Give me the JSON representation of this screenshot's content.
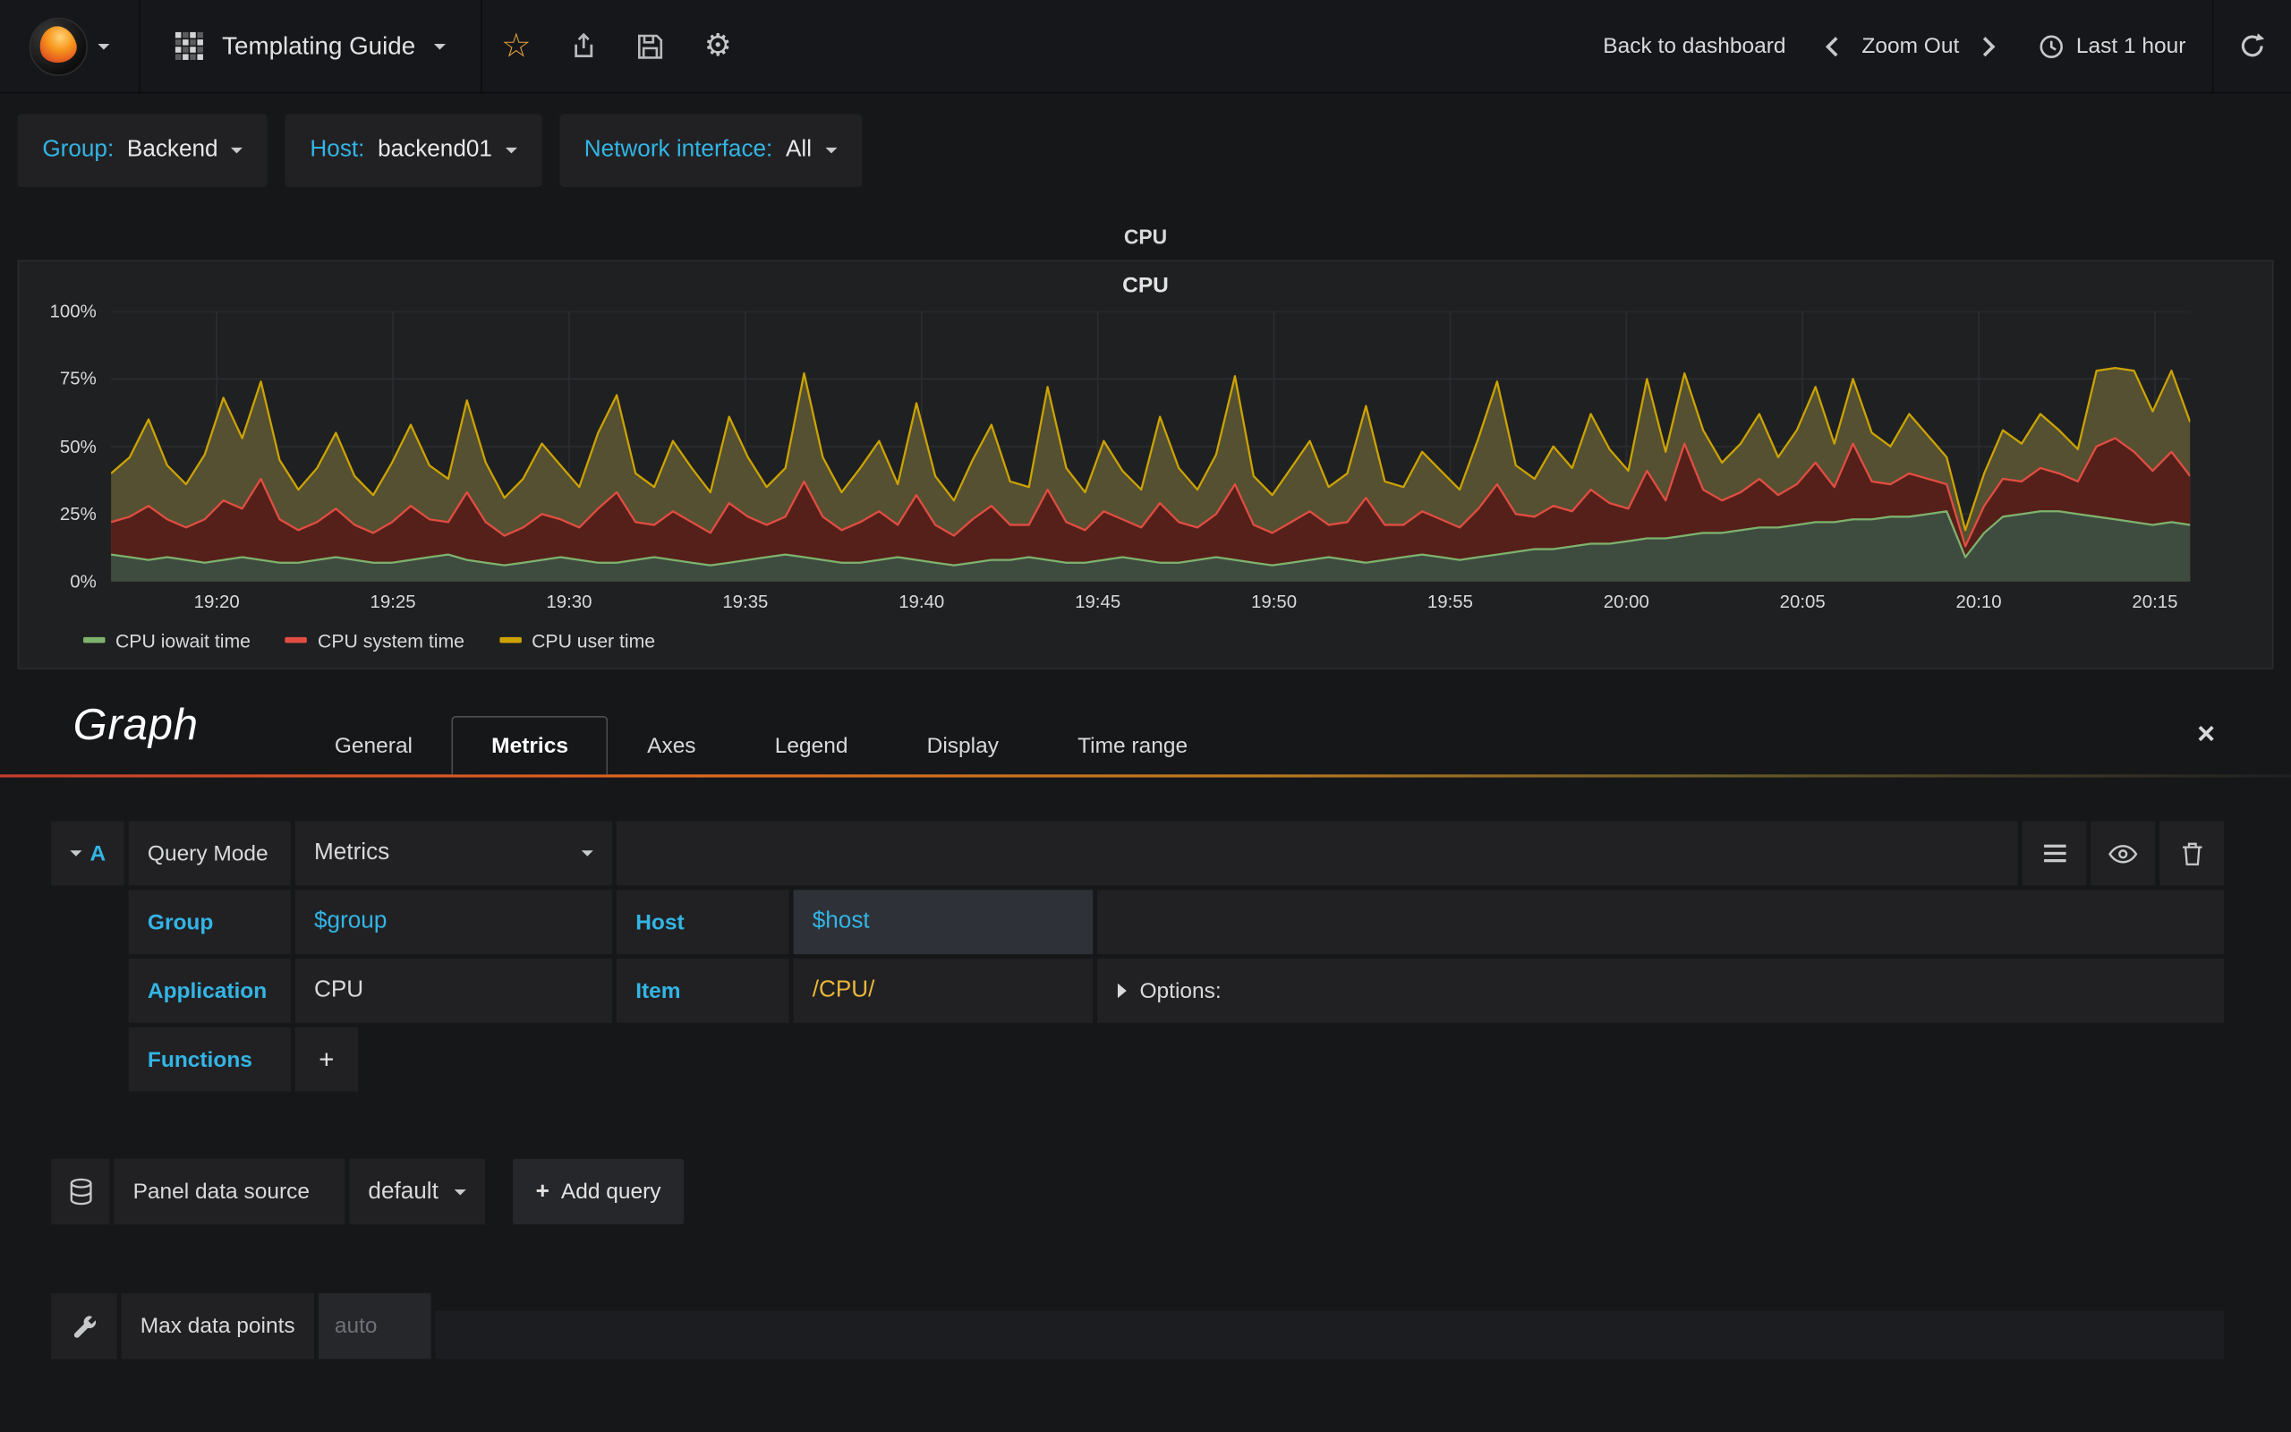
{
  "navbar": {
    "dashboard_title": "Templating Guide",
    "back_to_dashboard": "Back to dashboard",
    "zoom_out": "Zoom Out",
    "time_range": "Last 1 hour"
  },
  "icons": {
    "star": "☆",
    "gear": "⚙",
    "close": "×",
    "plus": "+"
  },
  "variables": [
    {
      "label": "Group:",
      "value": "Backend"
    },
    {
      "label": "Host:",
      "value": "backend01"
    },
    {
      "label": "Network interface:",
      "value": "All"
    }
  ],
  "panel": {
    "title": "CPU"
  },
  "chart_data": {
    "type": "area",
    "stacked": true,
    "title": "CPU",
    "ylim": [
      0,
      100
    ],
    "yticks": [
      "0%",
      "25%",
      "50%",
      "75%",
      "100%"
    ],
    "x_range": [
      "19:17",
      "20:16"
    ],
    "xticks": [
      "19:20",
      "19:25",
      "19:30",
      "19:35",
      "19:40",
      "19:45",
      "19:50",
      "19:55",
      "20:00",
      "20:05",
      "20:10",
      "20:15"
    ],
    "grid": true,
    "legend_position": "bottom-left",
    "series": [
      {
        "name": "CPU iowait time",
        "color": "#7eb26d",
        "fill": "#3e4c40",
        "values": [
          10,
          9,
          8,
          9,
          8,
          7,
          8,
          9,
          8,
          7,
          7,
          8,
          9,
          8,
          7,
          7,
          8,
          9,
          10,
          8,
          7,
          6,
          7,
          8,
          9,
          8,
          7,
          7,
          8,
          9,
          8,
          7,
          6,
          7,
          8,
          9,
          10,
          9,
          8,
          7,
          7,
          8,
          9,
          8,
          7,
          6,
          7,
          8,
          8,
          9,
          8,
          7,
          7,
          8,
          9,
          8,
          7,
          7,
          8,
          9,
          8,
          7,
          6,
          7,
          8,
          9,
          8,
          7,
          8,
          9,
          10,
          9,
          8,
          9,
          10,
          11,
          12,
          12,
          13,
          14,
          14,
          15,
          16,
          16,
          17,
          18,
          18,
          19,
          20,
          20,
          21,
          22,
          22,
          23,
          23,
          24,
          24,
          25,
          26,
          9,
          18,
          24,
          25,
          26,
          26,
          25,
          24,
          23,
          22,
          21,
          22,
          21
        ]
      },
      {
        "name": "CPU system time",
        "color": "#e24d42",
        "fill": "#55201a",
        "values": [
          12,
          15,
          20,
          14,
          12,
          16,
          22,
          18,
          30,
          16,
          12,
          14,
          18,
          13,
          11,
          15,
          20,
          14,
          12,
          25,
          15,
          11,
          13,
          17,
          14,
          12,
          20,
          26,
          14,
          12,
          18,
          15,
          12,
          22,
          16,
          12,
          14,
          28,
          16,
          12,
          15,
          18,
          12,
          24,
          14,
          11,
          16,
          20,
          13,
          12,
          26,
          15,
          12,
          18,
          14,
          12,
          22,
          15,
          12,
          16,
          28,
          14,
          12,
          15,
          18,
          12,
          14,
          24,
          13,
          12,
          16,
          14,
          12,
          18,
          26,
          14,
          12,
          16,
          13,
          20,
          15,
          12,
          25,
          14,
          34,
          16,
          12,
          14,
          18,
          12,
          15,
          22,
          13,
          28,
          14,
          12,
          16,
          13,
          10,
          4,
          10,
          14,
          12,
          16,
          14,
          12,
          26,
          30,
          26,
          20,
          26,
          18
        ]
      },
      {
        "name": "CPU user time",
        "color": "#cca300",
        "fill": "#555031",
        "values": [
          18,
          22,
          32,
          20,
          16,
          24,
          38,
          26,
          36,
          22,
          15,
          20,
          28,
          18,
          14,
          22,
          30,
          20,
          16,
          34,
          22,
          14,
          18,
          26,
          20,
          15,
          28,
          36,
          18,
          14,
          26,
          20,
          15,
          32,
          22,
          14,
          18,
          40,
          22,
          14,
          20,
          26,
          15,
          34,
          18,
          13,
          22,
          30,
          16,
          14,
          38,
          20,
          14,
          26,
          18,
          14,
          32,
          20,
          14,
          22,
          40,
          18,
          14,
          20,
          26,
          14,
          18,
          34,
          16,
          14,
          22,
          18,
          14,
          26,
          38,
          18,
          14,
          22,
          16,
          28,
          20,
          14,
          34,
          18,
          26,
          22,
          14,
          18,
          24,
          14,
          20,
          28,
          16,
          24,
          18,
          14,
          22,
          16,
          10,
          6,
          12,
          18,
          14,
          20,
          16,
          12,
          28,
          26,
          30,
          22,
          30,
          20
        ]
      }
    ]
  },
  "editor": {
    "panel_type": "Graph",
    "tabs": [
      "General",
      "Metrics",
      "Axes",
      "Legend",
      "Display",
      "Time range"
    ],
    "active_tab": "Metrics"
  },
  "query": {
    "row_letter": "A",
    "query_mode_label": "Query Mode",
    "query_mode_value": "Metrics",
    "group_label": "Group",
    "group_value": "$group",
    "host_label": "Host",
    "host_value": "$host",
    "application_label": "Application",
    "application_value": "CPU",
    "item_label": "Item",
    "item_value": "/CPU/",
    "options_label": "Options:",
    "functions_label": "Functions",
    "add_function_label": "+"
  },
  "datasource": {
    "label": "Panel data source",
    "value": "default",
    "add_query_label": "Add query"
  },
  "settings": {
    "max_data_points_label": "Max data points",
    "max_data_points_placeholder": "auto"
  },
  "colors": {
    "accent_cyan": "#33b5e5",
    "accent_orange": "#e0691f",
    "variable_yellow": "#eab839",
    "page_bg": "#161719",
    "cell_bg": "#212124"
  }
}
